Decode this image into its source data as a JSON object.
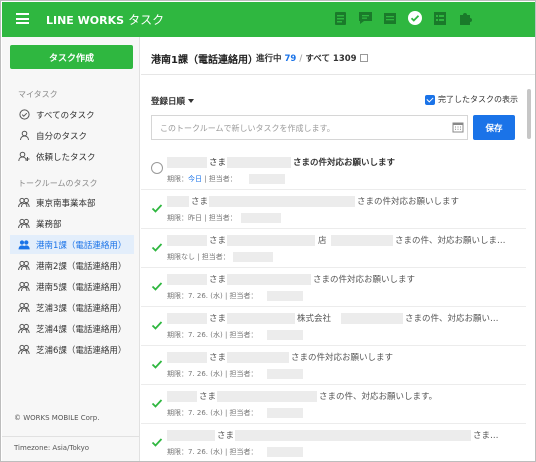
{
  "header": {
    "brand": "LINE WORKS",
    "title": "タスク",
    "apps": [
      "note-icon",
      "chat-icon",
      "calendar-icon",
      "task-icon",
      "form-icon",
      "puzzle-icon"
    ]
  },
  "sidebar": {
    "create_label": "タスク作成",
    "mytask_title": "マイタスク",
    "mytask_items": [
      {
        "label": "すべてのタスク",
        "icon": "check-circle-icon"
      },
      {
        "label": "自分のタスク",
        "icon": "person-icon"
      },
      {
        "label": "依頼したタスク",
        "icon": "person-plus-icon"
      }
    ],
    "room_title": "トークルームのタスク",
    "room_items": [
      {
        "label": "東京南事業本部",
        "icon": "group-icon"
      },
      {
        "label": "業務部",
        "icon": "group-icon"
      },
      {
        "label": "港南1課（電話連絡用）",
        "icon": "group-icon",
        "active": true
      },
      {
        "label": "港南2課（電話連絡用）",
        "icon": "group-icon"
      },
      {
        "label": "港南5課（電話連絡用）",
        "icon": "group-icon"
      },
      {
        "label": "芝浦3課（電話連絡用）",
        "icon": "group-icon"
      },
      {
        "label": "芝浦4課（電話連絡用）",
        "icon": "group-icon"
      },
      {
        "label": "芝浦6課（電話連絡用）",
        "icon": "group-icon"
      }
    ],
    "copyright": "© WORKS MOBILE Corp.",
    "timezone": "Timezone: Asia/Tokyo"
  },
  "main": {
    "room_name": "港南1課（電話連絡用）",
    "in_progress_label": "進行中",
    "in_progress_count": "79",
    "separator": "/",
    "total_label": "すべて",
    "total_count": "1309",
    "sort_label": "登録日順",
    "show_done_label": "完了したタスクの表示",
    "new_task_placeholder": "このトークルームで新しいタスクを作成します。",
    "save_label": "保存",
    "tasks": [
      {
        "done": false,
        "texts": [
          "さま",
          "さまの件対応お願いします"
        ],
        "sub_prefix": "期限：",
        "due": "今日",
        "sub_suffix": " | 担当者："
      },
      {
        "done": true,
        "texts": [
          "さま",
          "さまの件対応お願いします"
        ],
        "sub": "期限：昨日 | 担当者："
      },
      {
        "done": true,
        "texts": [
          "さま",
          "店",
          "さまの件、対応お願いしま…"
        ],
        "sub": "期限なし | 担当者："
      },
      {
        "done": true,
        "texts": [
          "さま",
          "さまの件対応お願いします"
        ],
        "sub": "期限：7. 26. (水) | 担当者："
      },
      {
        "done": true,
        "texts": [
          "さま",
          "株式会社",
          "さまの件、対応お願い…"
        ],
        "sub": "期限：7. 26. (水) | 担当者："
      },
      {
        "done": true,
        "texts": [
          "さま",
          "さまの件対応お願いします"
        ],
        "sub": "期限：7. 26. (水) | 担当者："
      },
      {
        "done": true,
        "texts": [
          "さま",
          "さまの件、対応お願いします。"
        ],
        "sub": "期限：7. 26. (水) | 担当者："
      },
      {
        "done": true,
        "texts": [
          "さま",
          "さま…"
        ],
        "sub": "期限：7. 26. (水) | 担当者："
      }
    ]
  },
  "colors": {
    "brand_green": "#2fb740",
    "accent_blue": "#1a73e8",
    "active_bg": "#e3eefb"
  }
}
